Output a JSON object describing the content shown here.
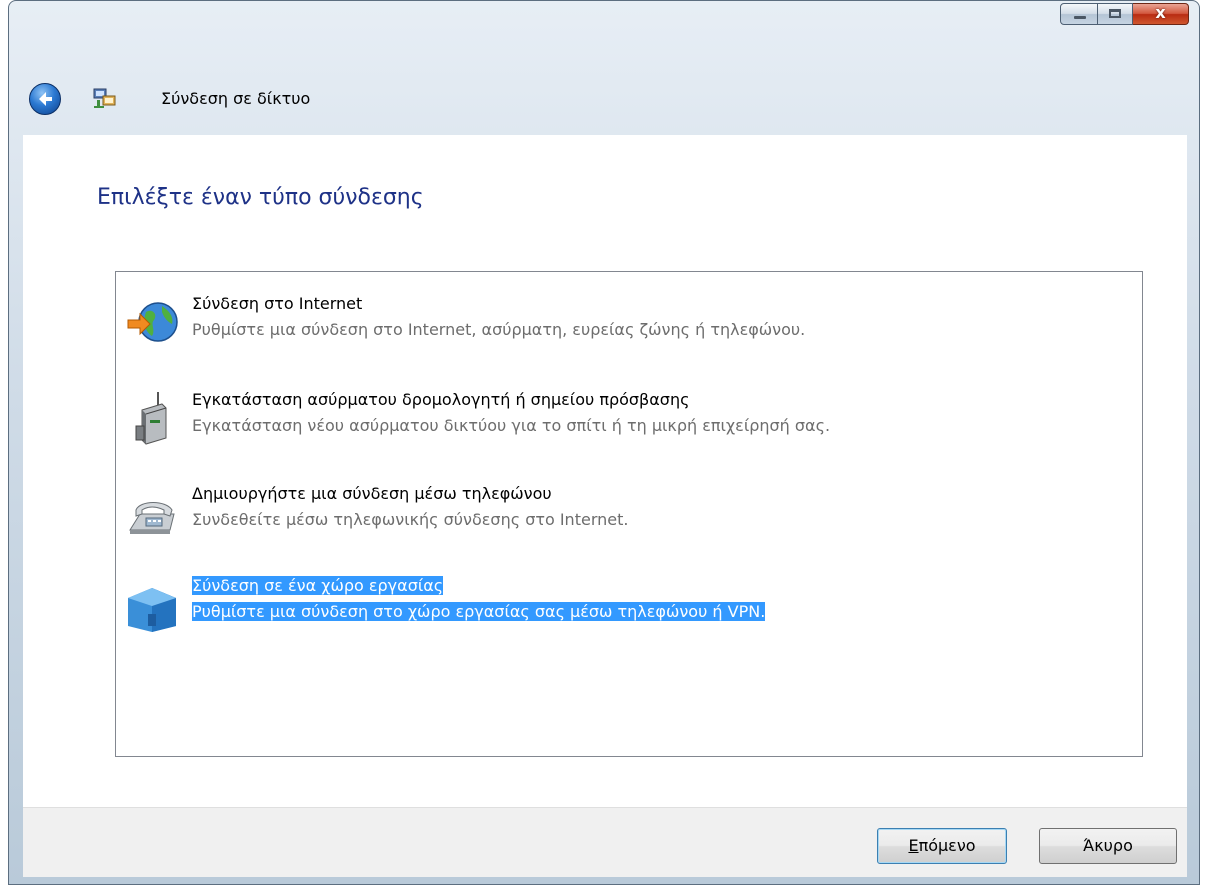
{
  "window": {
    "buttons": {
      "minimize": "minimize",
      "maximize": "maximize",
      "close": "x"
    }
  },
  "nav": {
    "title": "Σύνδεση σε δίκτυο"
  },
  "heading": "Επιλέξτε έναν τύπο σύνδεσης",
  "options": [
    {
      "title": "Σύνδεση στο Internet",
      "description": "Ρυθμίστε μια σύνδεση στο Internet, ασύρματη, ευρείας ζώνης ή τηλεφώνου.",
      "icon": "globe-internet-icon",
      "selected": false
    },
    {
      "title": "Εγκατάσταση ασύρματου δρομολογητή ή σημείου πρόσβασης",
      "description": "Εγκατάσταση νέου ασύρματου δικτύου για το σπίτι ή τη μικρή επιχείρησή σας.",
      "icon": "wireless-router-icon",
      "selected": false
    },
    {
      "title": "Δημιουργήστε μια σύνδεση μέσω τηλεφώνου",
      "description": "Συνδεθείτε μέσω τηλεφωνικής σύνδεσης στο Internet.",
      "icon": "telephone-modem-icon",
      "selected": false
    },
    {
      "title": "Σύνδεση σε ένα χώρο εργασίας",
      "description": "Ρυθμίστε μια σύνδεση στο χώρο εργασίας σας μέσω τηλεφώνου ή VPN.",
      "icon": "workplace-building-icon",
      "selected": true
    }
  ],
  "footer": {
    "next_first": "Ε",
    "next_rest": "πόμενο",
    "cancel": "Άκυρο"
  },
  "colors": {
    "heading": "#1e3287",
    "selection": "#3399ff",
    "footer_bg": "#f0f0f0"
  }
}
